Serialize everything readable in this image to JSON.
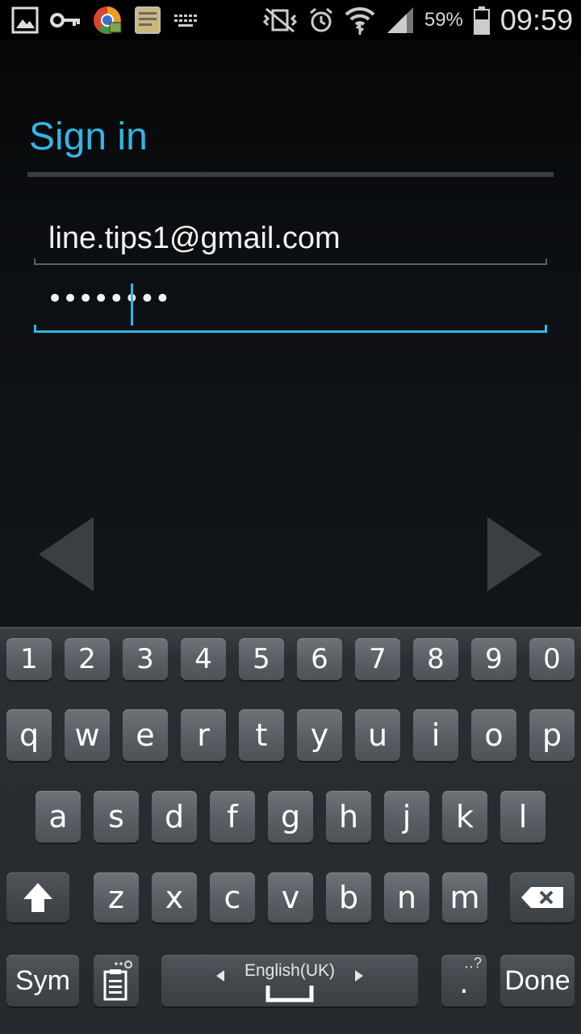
{
  "status_bar": {
    "icons_left": [
      "gallery-icon",
      "key-icon",
      "chrome-icon",
      "memo-app-icon",
      "keyboard-notification-icon"
    ],
    "icons_right": [
      "vibrate-mute-icon",
      "alarm-icon",
      "wifi-icon",
      "signal-icon"
    ],
    "battery_percent": "59%",
    "battery_level": 0.59,
    "time": "09:59"
  },
  "signin": {
    "title": "Sign in",
    "email_value": "line.tips1@gmail.com",
    "password_value": "••••••••",
    "accent_color": "#33b5e5"
  },
  "navigation": {
    "prev_icon": "arrow-left-icon",
    "next_icon": "arrow-right-icon"
  },
  "keyboard": {
    "number_row": [
      "1",
      "2",
      "3",
      "4",
      "5",
      "6",
      "7",
      "8",
      "9",
      "0"
    ],
    "row1": [
      "q",
      "w",
      "e",
      "r",
      "t",
      "y",
      "u",
      "i",
      "o",
      "p"
    ],
    "row2": [
      "a",
      "s",
      "d",
      "f",
      "g",
      "h",
      "j",
      "k",
      "l"
    ],
    "row3": [
      "z",
      "x",
      "c",
      "v",
      "b",
      "n",
      "m"
    ],
    "sym_label": "Sym",
    "language_label": "English(UK)",
    "period_label": ".",
    "period_hint": "‥?",
    "done_label": "Done"
  }
}
